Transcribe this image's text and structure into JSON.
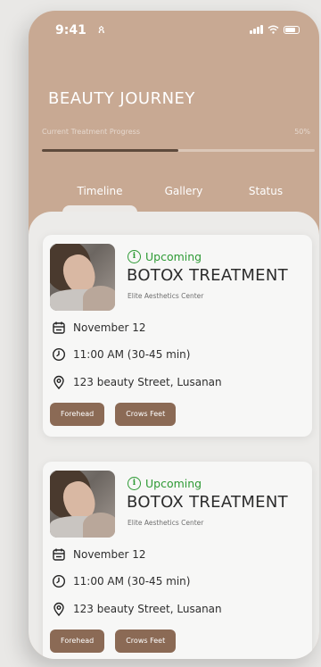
{
  "status_bar": {
    "time": "9:41",
    "extra": "ጰ"
  },
  "header": {
    "title": "BEAUTY JOURNEY",
    "progress_label": "Current Treatment Progress",
    "progress_value": "50%",
    "progress_fraction": 0.5
  },
  "tabs": [
    {
      "label": "Timeline"
    },
    {
      "label": "Gallery"
    },
    {
      "label": "Status"
    }
  ],
  "cards": [
    {
      "status": "Upcoming",
      "title": "BOTOX TREATMENT",
      "clinic": "Elite Aesthetics Center",
      "date": "November 12",
      "time": "11:00 AM (30-45 min)",
      "location": "123 beauty Street, Lusanan",
      "areas": [
        "Forehead",
        "Crows Feet"
      ]
    },
    {
      "status": "Upcoming",
      "title": "BOTOX TREATMENT",
      "clinic": "Elite Aesthetics Center",
      "date": "November 12",
      "time": "11:00 AM (30-45 min)",
      "location": "123 beauty Street, Lusanan",
      "areas": [
        "Forehead",
        "Crows Feet"
      ]
    }
  ],
  "colors": {
    "header_bg": "#c8a993",
    "accent_brown": "#8b6a55",
    "status_green": "#2e9a35",
    "content_bg": "#ecebe9"
  },
  "icons": [
    "signal-icon",
    "wifi-icon",
    "battery-icon",
    "info-icon",
    "calendar-icon",
    "clock-icon",
    "location-pin-icon"
  ]
}
